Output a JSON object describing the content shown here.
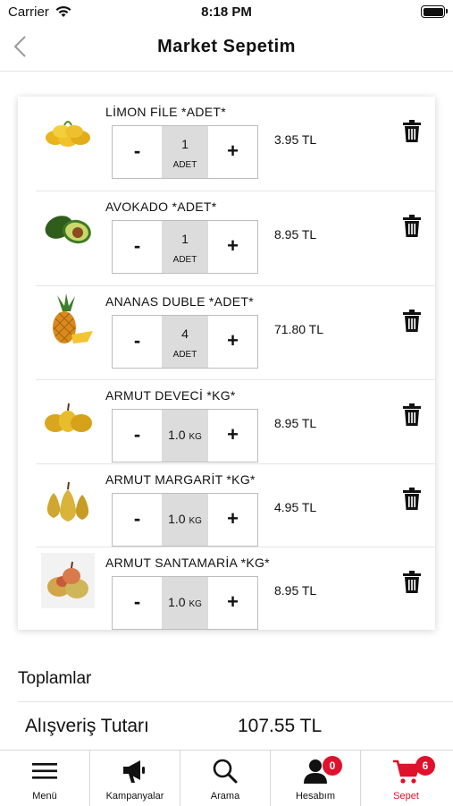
{
  "status_bar": {
    "carrier": "Carrier",
    "time": "8:18 PM"
  },
  "nav": {
    "title": "Market Sepetim"
  },
  "items": [
    {
      "name": "LİMON FİLE *ADET*",
      "quantity": "1",
      "unit": "ADET",
      "price": "3.95 TL",
      "image": "lemon-bag"
    },
    {
      "name": "AVOKADO *ADET*",
      "quantity": "1",
      "unit": "ADET",
      "price": "8.95 TL",
      "image": "avocado"
    },
    {
      "name": "ANANAS DUBLE *ADET*",
      "quantity": "4",
      "unit": "ADET",
      "price": "71.80 TL",
      "image": "pineapple"
    },
    {
      "name": "ARMUT DEVECİ *KG*",
      "quantity": "1.0",
      "unit": "KG",
      "price": "8.95 TL",
      "image": "pear-yellow"
    },
    {
      "name": "ARMUT MARGARİT *KG*",
      "quantity": "1.0",
      "unit": "KG",
      "price": "4.95 TL",
      "image": "pear-green"
    },
    {
      "name": "ARMUT SANTAMARİA *KG*",
      "quantity": "1.0",
      "unit": "KG",
      "price": "8.95 TL",
      "image": "pear-red"
    }
  ],
  "stepper": {
    "minus_label": "-",
    "plus_label": "+"
  },
  "totals": {
    "title": "Toplamlar",
    "label": "Alışveriş Tutarı",
    "value": "107.55 TL"
  },
  "tabs": [
    {
      "label": "Menü",
      "icon": "menu-icon"
    },
    {
      "label": "Kampanyalar",
      "icon": "megaphone-icon"
    },
    {
      "label": "Arama",
      "icon": "search-icon"
    },
    {
      "label": "Hesabım",
      "icon": "user-icon",
      "badge": "0"
    },
    {
      "label": "Sepet",
      "icon": "cart-icon",
      "badge": "6",
      "active": true
    }
  ],
  "colors": {
    "accent": "#e0112b",
    "text": "#111111",
    "qty_bg": "#dcdcdc"
  }
}
